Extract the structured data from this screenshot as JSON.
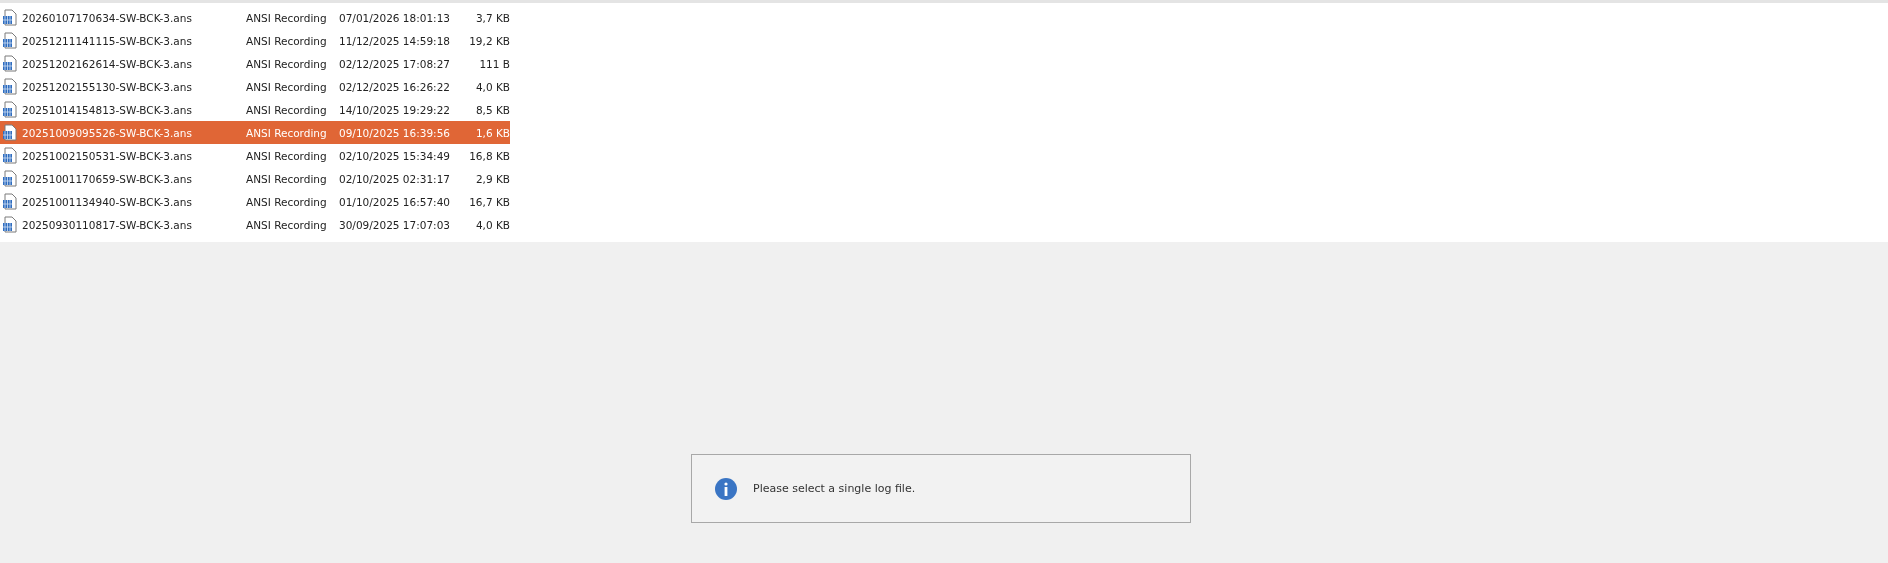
{
  "files": [
    {
      "name": "20260107170634-SW-BCK-3.ans",
      "type": "ANSI Recording",
      "date": "07/01/2026 18:01:13",
      "size": "3,7 KB",
      "selected": false
    },
    {
      "name": "20251211141115-SW-BCK-3.ans",
      "type": "ANSI Recording",
      "date": "11/12/2025 14:59:18",
      "size": "19,2 KB",
      "selected": false
    },
    {
      "name": "20251202162614-SW-BCK-3.ans",
      "type": "ANSI Recording",
      "date": "02/12/2025 17:08:27",
      "size": "111 B",
      "selected": false
    },
    {
      "name": "20251202155130-SW-BCK-3.ans",
      "type": "ANSI Recording",
      "date": "02/12/2025 16:26:22",
      "size": "4,0 KB",
      "selected": false
    },
    {
      "name": "20251014154813-SW-BCK-3.ans",
      "type": "ANSI Recording",
      "date": "14/10/2025 19:29:22",
      "size": "8,5 KB",
      "selected": false
    },
    {
      "name": "20251009095526-SW-BCK-3.ans",
      "type": "ANSI Recording",
      "date": "09/10/2025 16:39:56",
      "size": "1,6 KB",
      "selected": true
    },
    {
      "name": "20251002150531-SW-BCK-3.ans",
      "type": "ANSI Recording",
      "date": "02/10/2025 15:34:49",
      "size": "16,8 KB",
      "selected": false
    },
    {
      "name": "20251001170659-SW-BCK-3.ans",
      "type": "ANSI Recording",
      "date": "02/10/2025 02:31:17",
      "size": "2,9 KB",
      "selected": false
    },
    {
      "name": "20251001134940-SW-BCK-3.ans",
      "type": "ANSI Recording",
      "date": "01/10/2025 16:57:40",
      "size": "16,7 KB",
      "selected": false
    },
    {
      "name": "20250930110817-SW-BCK-3.ans",
      "type": "ANSI Recording",
      "date": "30/09/2025 17:07:03",
      "size": "4,0 KB",
      "selected": false
    }
  ],
  "message": {
    "text": "Please select a single log file."
  }
}
